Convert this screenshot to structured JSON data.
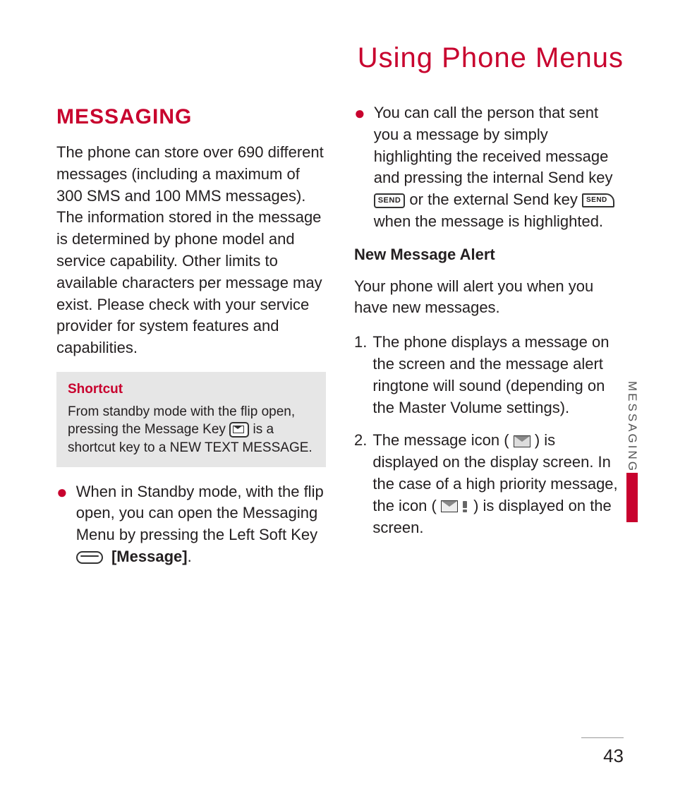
{
  "chapter_title": "Using Phone Menus",
  "side_tab": "MESSAGING",
  "page_number": "43",
  "left_col": {
    "heading": "MESSAGING",
    "intro": "The phone can store over 690 different messages (including a maximum of 300 SMS and 100 MMS messages). The information stored in the message is determined by phone model and service capability. Other limits to available characters per message may exist. Please check with your service provider for system features and capabilities.",
    "shortcut": {
      "title": "Shortcut",
      "text_before_icon": "From standby mode with the flip open, pressing the Message Key ",
      "text_after_icon": " is a shortcut key to a NEW TEXT MESSAGE."
    },
    "bullet1": {
      "text_before_icon": "When in Standby mode, with the flip open, you can open the Messaging Menu by pressing the Left Soft Key ",
      "message_label": "[Message]",
      "after": "."
    }
  },
  "right_col": {
    "bullet2": {
      "a": "You can call the person that sent you a message by simply highlighting the received message and pressing the internal Send key ",
      "b": " or the external Send key ",
      "c": " when the message is highlighted."
    },
    "alert_heading": "New Message Alert",
    "alert_intro": "Your phone will alert you when you have new messages.",
    "step1_num": "1.",
    "step1_text": "The phone displays a message on the screen and the message alert ringtone will sound (depending on the Master Volume settings).",
    "step2_num": "2.",
    "step2": {
      "a": "The message icon (",
      "b": ") is displayed on the display screen. In the case of a high priority message, the icon (",
      "c": ") is displayed on the screen."
    }
  },
  "icon_labels": {
    "send_internal": "SEND",
    "send_external": "SEND"
  }
}
